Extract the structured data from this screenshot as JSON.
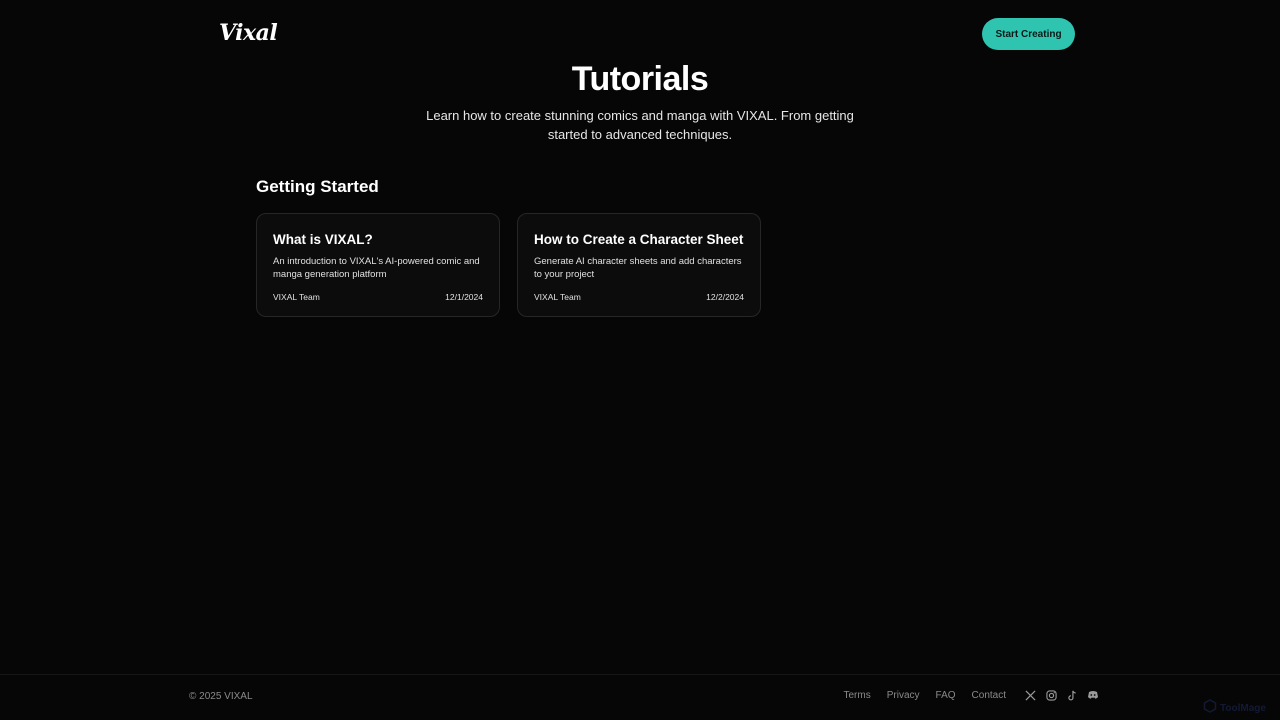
{
  "header": {
    "logo_text": "Vixal",
    "cta_label": "Start Creating",
    "accent_color": "#2ec4b0"
  },
  "hero": {
    "title": "Tutorials",
    "subtitle": "Learn how to create stunning comics and manga with VIXAL. From getting started to advanced techniques."
  },
  "sections": [
    {
      "title": "Getting Started",
      "cards": [
        {
          "title": "What is VIXAL?",
          "description": "An introduction to VIXAL's AI-powered comic and manga generation platform",
          "author": "VIXAL Team",
          "date": "12/1/2024"
        },
        {
          "title": "How to Create a Character Sheet",
          "description": "Generate AI character sheets and add characters to your project",
          "author": "VIXAL Team",
          "date": "12/2/2024"
        }
      ]
    }
  ],
  "footer": {
    "copyright": "© 2025 VIXAL",
    "links": [
      "Terms",
      "Privacy",
      "FAQ",
      "Contact"
    ],
    "social_icons": [
      "x-icon",
      "instagram-icon",
      "tiktok-icon",
      "discord-icon"
    ],
    "watermark_text": "ToolMage"
  }
}
